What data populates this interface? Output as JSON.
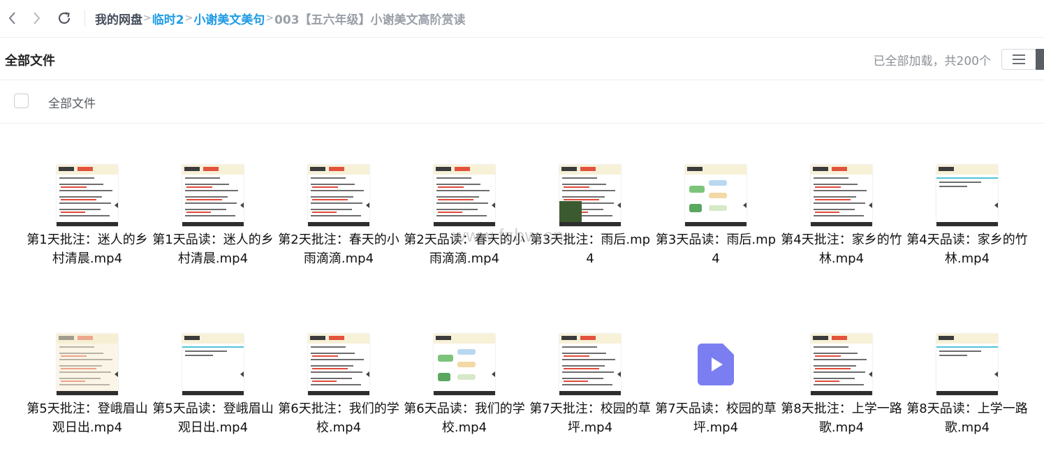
{
  "nav": {
    "back_icon": "chevron-left-icon",
    "forward_icon": "chevron-right-icon",
    "refresh_icon": "refresh-icon"
  },
  "breadcrumb": {
    "items": [
      "我的网盘",
      "临时2",
      "小谢美文美句",
      "003【五六年级】小谢美文高阶赏读"
    ],
    "separator": ">"
  },
  "subheader": {
    "title": "全部文件",
    "status": "已全部加载，共200个",
    "view_icon": "list-view-icon"
  },
  "list_header": {
    "label": "全部文件"
  },
  "files": [
    {
      "name": "第1天批注：迷人的乡村清晨.mp4",
      "thumb": "slide"
    },
    {
      "name": "第1天品读：迷人的乡村清晨.mp4",
      "thumb": "slide"
    },
    {
      "name": "第2天批注：春天的小雨滴滴.mp4",
      "thumb": "slide"
    },
    {
      "name": "第2天品读：春天的小雨滴滴.mp4",
      "thumb": "slide"
    },
    {
      "name": "第3天批注：雨后.mp4",
      "thumb": "slide-image"
    },
    {
      "name": "第3天品读：雨后.mp4",
      "thumb": "mindmap"
    },
    {
      "name": "第4天批注：家乡的竹林.mp4",
      "thumb": "slide"
    },
    {
      "name": "第4天品读：家乡的竹林.mp4",
      "thumb": "slide-plain"
    },
    {
      "name": "第5天批注：登峨眉山观日出.mp4",
      "thumb": "slide-book"
    },
    {
      "name": "第5天品读：登峨眉山观日出.mp4",
      "thumb": "slide-plain"
    },
    {
      "name": "第6天批注：我们的学校.mp4",
      "thumb": "slide"
    },
    {
      "name": "第6天品读：我们的学校.mp4",
      "thumb": "mindmap"
    },
    {
      "name": "第7天批注：校园的草坪.mp4",
      "thumb": "slide"
    },
    {
      "name": "第7天品读：校园的草坪.mp4",
      "thumb": "video-icon"
    },
    {
      "name": "第8天批注：上学一路歌.mp4",
      "thumb": "slide"
    },
    {
      "name": "第8天品读：上学一路歌.mp4",
      "thumb": "slide-plain"
    }
  ],
  "watermark": "www.fzbw.cn",
  "colors": {
    "breadcrumb_link": "#1e9be6",
    "video_icon": "#7b7ef0"
  }
}
